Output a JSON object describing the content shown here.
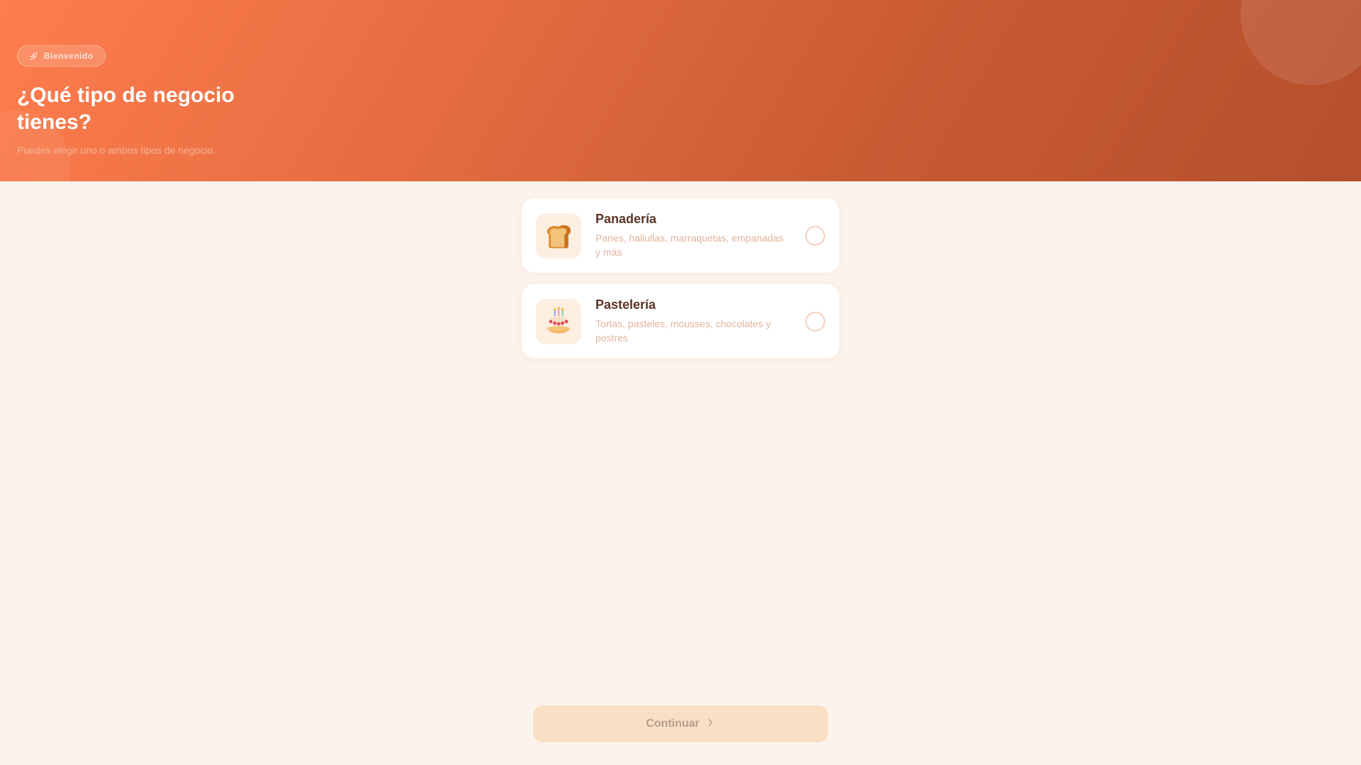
{
  "header": {
    "badge_label": "Bienvenido",
    "badge_icon": "sparkles-icon",
    "title": "¿Qué tipo de negocio tienes?",
    "subtitle": "Puedes elegir uno o ambos tipos de negocio."
  },
  "options": [
    {
      "icon": "bread-icon",
      "title": "Panadería",
      "description": "Panes, hallullas, marraquetas, empanadas y más",
      "selected": false
    },
    {
      "icon": "birthday-cake-icon",
      "title": "Pastelería",
      "description": "Tortas, pasteles, mousses, chocolates y postres",
      "selected": false
    }
  ],
  "footer": {
    "continue_label": "Continuar",
    "continue_icon": "chevron-right-icon",
    "continue_enabled": false
  },
  "colors": {
    "primary": "#fe7d4e",
    "primary_dark": "#b54f2c",
    "background": "#fcf3ec",
    "title_text": "#5a3424",
    "muted_text": "#e0b39b",
    "button_disabled": "#f9dfc3"
  }
}
